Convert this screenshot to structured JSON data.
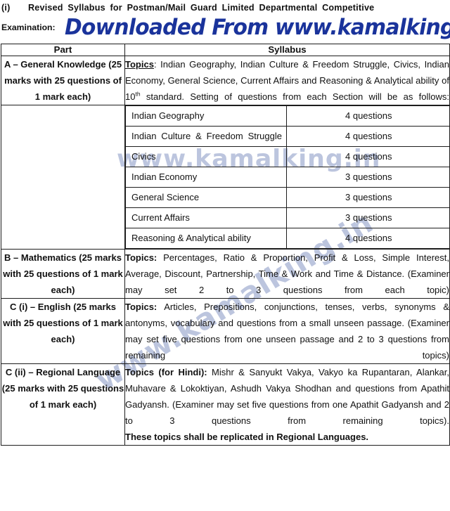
{
  "heading": {
    "roman": "(i)",
    "line1": "Revised Syllabus for Postman/Mail Guard Limited Departmental Competitive",
    "line2": "Examination:",
    "banner": "Downloaded From www.kamalking.in",
    "banner_color": "#1a339b"
  },
  "watermark": {
    "text": "www.kamalking.in",
    "color": "#b9c2dd"
  },
  "table": {
    "headers": {
      "part": "Part",
      "syllabus": "Syllabus"
    },
    "rows": [
      {
        "part": "A – General Knowledge (25 marks with 25 questions of 1 mark each)",
        "syllabus_label": "Topics",
        "syllabus_sep": ": ",
        "syllabus_text_a": "Indian Geography, Indian Culture & Freedom Struggle, Civics, Indian Economy, General Science, Current Affairs and Reasoning & Analytical ability of 10",
        "syllabus_sup": "th",
        "syllabus_text_b": " standard.  Setting of questions from each Section will be as follows:"
      },
      {
        "part": "B – Mathematics (25 marks with 25 questions of 1 mark each)",
        "syllabus_label": "Topics:",
        "syllabus_text": " Percentages, Ratio & Proportion, Profit & Loss, Simple Interest, Average, Discount, Partnership, Time & Work and Time & Distance. (Examiner may set 2 to 3 questions from each topic)"
      },
      {
        "part": "C (i) – English (25 marks with 25 questions of 1 mark each)",
        "syllabus_label": "Topics:",
        "syllabus_text": " Articles, Prepositions, conjunctions, tenses, verbs, synonyms & antonyms, vocabulary and questions from a small unseen passage. (Examiner may set five questions from one unseen passage and 2 to 3 questions from remaining topics)"
      },
      {
        "part": "C (ii) – Regional Language (25 marks with 25 questions of 1 mark each)",
        "syllabus_label": "Topics (for Hindi):",
        "syllabus_text": " Mishr & Sanyukt Vakya, Vakyo ka Rupantaran, Alankar, Muhavare & Lokoktiyan, Ashudh Vakya Shodhan and questions from Apathit Gadyansh. (Examiner may set five questions from one Apathit Gadyansh and 2 to 3 questions from remaining topics).",
        "syllabus_note": "These topics shall be replicated in Regional Languages."
      }
    ],
    "section_breakdown": [
      {
        "name": "Indian Geography",
        "questions": "4 questions",
        "justify": false
      },
      {
        "name": "Indian Culture & Freedom Struggle",
        "questions": "4 questions",
        "justify": true
      },
      {
        "name": "Civics",
        "questions": "4 questions",
        "justify": false
      },
      {
        "name": "Indian Economy",
        "questions": "3 questions",
        "justify": false
      },
      {
        "name": "General Science",
        "questions": "3 questions",
        "justify": false
      },
      {
        "name": "Current Affairs",
        "questions": "3 questions",
        "justify": false
      },
      {
        "name": "Reasoning & Analytical ability",
        "questions": "4 questions",
        "justify": false
      }
    ]
  }
}
